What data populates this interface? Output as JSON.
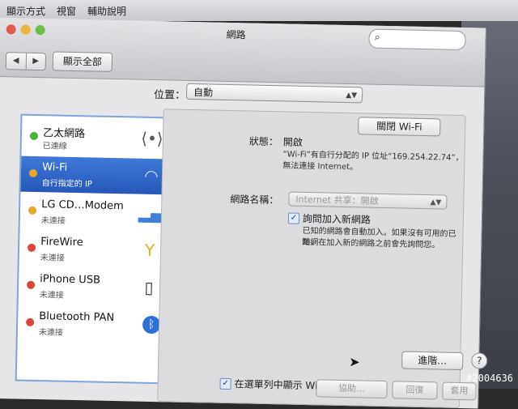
{
  "menubar": {
    "items": [
      "顯示方式",
      "視窗",
      "輔助說明"
    ]
  },
  "window": {
    "title": "網路",
    "nav": {
      "back": "◀",
      "forward": "▶"
    },
    "show_all": "顯示全部",
    "search": {
      "placeholder": ""
    }
  },
  "location": {
    "label": "位置：",
    "value": "自動"
  },
  "services": [
    {
      "name": "乙太網路",
      "status": "已連線",
      "dot": "green",
      "icon": "ethernet-icon"
    },
    {
      "name": "Wi-Fi",
      "status": "自行指定的 IP",
      "dot": "yellow",
      "icon": "wifi-icon",
      "selected": true
    },
    {
      "name": "LG CD…Modem",
      "status": "未連接",
      "dot": "yellow",
      "icon": "signal-bars-icon"
    },
    {
      "name": "FireWire",
      "status": "未連接",
      "dot": "red",
      "icon": "firewire-icon"
    },
    {
      "name": "iPhone USB",
      "status": "未連接",
      "dot": "red",
      "icon": "iphone-icon"
    },
    {
      "name": "Bluetooth PAN",
      "status": "未連接",
      "dot": "red",
      "icon": "bluetooth-icon"
    }
  ],
  "detail": {
    "status_label": "狀態：",
    "status_value": "開啟",
    "turn_off_button": "關閉 Wi-Fi",
    "status_desc_1": "“Wi-Fi”有自行分配的 IP 位址“169.254.22.74”，",
    "status_desc_2": "無法連接 Internet。",
    "network_name_label": "網路名稱：",
    "network_name_value": "Internet 共享：開啟",
    "ask_join_label": "詢問加入新網路",
    "ask_join_desc_1": "已知的網路會自動加入。如果沒有可用的已知網",
    "ask_join_desc_2": "路，在加入新的網路之前會先詢問您。",
    "advanced_button": "進階…",
    "help": "?",
    "show_in_menubar_label": "在選單列中顯示 Wi-Fi 狀態",
    "assist_button": "協助…",
    "revert_button": "回復",
    "apply_button": "套用"
  },
  "watermark": "#2004636",
  "colors": {
    "selection": "#2558b8",
    "status_green": "#4caf3a",
    "status_yellow": "#e3a72b",
    "status_red": "#d9473b"
  }
}
